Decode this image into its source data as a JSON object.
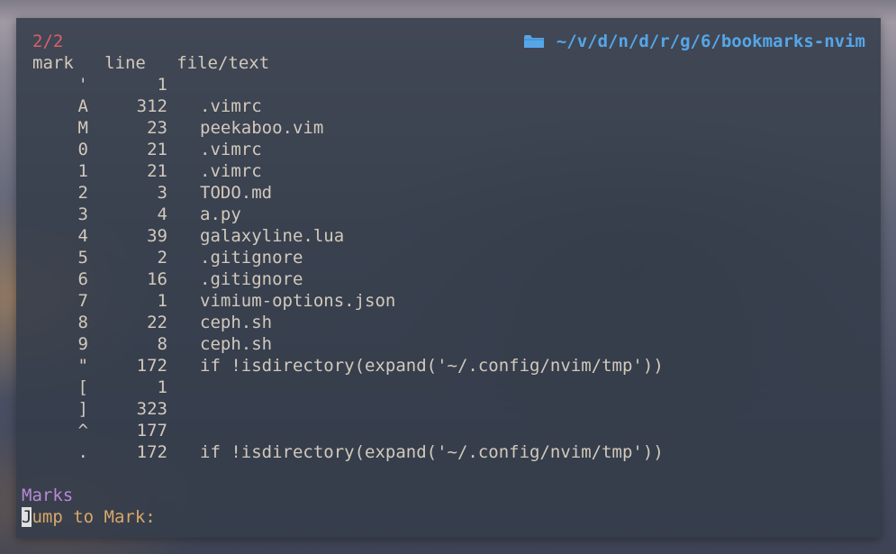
{
  "header": {
    "count": "2/2",
    "path": "~/v/d/n/d/r/g/6/bookmarks-nvim",
    "path_icon": "folder-icon"
  },
  "columns": {
    "mark": "mark",
    "line": "line",
    "file": "file/text"
  },
  "rows": [
    {
      "mark": "'",
      "line": "1",
      "file": ""
    },
    {
      "mark": "A",
      "line": "312",
      "file": ".vimrc"
    },
    {
      "mark": "M",
      "line": "23",
      "file": "peekaboo.vim"
    },
    {
      "mark": "0",
      "line": "21",
      "file": ".vimrc"
    },
    {
      "mark": "1",
      "line": "21",
      "file": ".vimrc"
    },
    {
      "mark": "2",
      "line": "3",
      "file": "TODO.md"
    },
    {
      "mark": "3",
      "line": "4",
      "file": "a.py"
    },
    {
      "mark": "4",
      "line": "39",
      "file": "galaxyline.lua"
    },
    {
      "mark": "5",
      "line": "2",
      "file": ".gitignore"
    },
    {
      "mark": "6",
      "line": "16",
      "file": ".gitignore"
    },
    {
      "mark": "7",
      "line": "1",
      "file": "vimium-options.json"
    },
    {
      "mark": "8",
      "line": "22",
      "file": "ceph.sh"
    },
    {
      "mark": "9",
      "line": "8",
      "file": "ceph.sh"
    },
    {
      "mark": "\"",
      "line": "172",
      "file": "if !isdirectory(expand('~/.config/nvim/tmp'))"
    },
    {
      "mark": "[",
      "line": "1",
      "file": ""
    },
    {
      "mark": "]",
      "line": "323",
      "file": ""
    },
    {
      "mark": "^",
      "line": "177",
      "file": ""
    },
    {
      "mark": ".",
      "line": "172",
      "file": "if !isdirectory(expand('~/.config/nvim/tmp'))"
    }
  ],
  "footer": {
    "title": "Marks",
    "prompt_first": "J",
    "prompt_rest": "ump to Mark:"
  },
  "colors": {
    "count": "#d9606a",
    "path": "#55a6e8",
    "text": "#d2c9bc",
    "marks_title": "#b68ad6",
    "prompt": "#d8a869"
  }
}
